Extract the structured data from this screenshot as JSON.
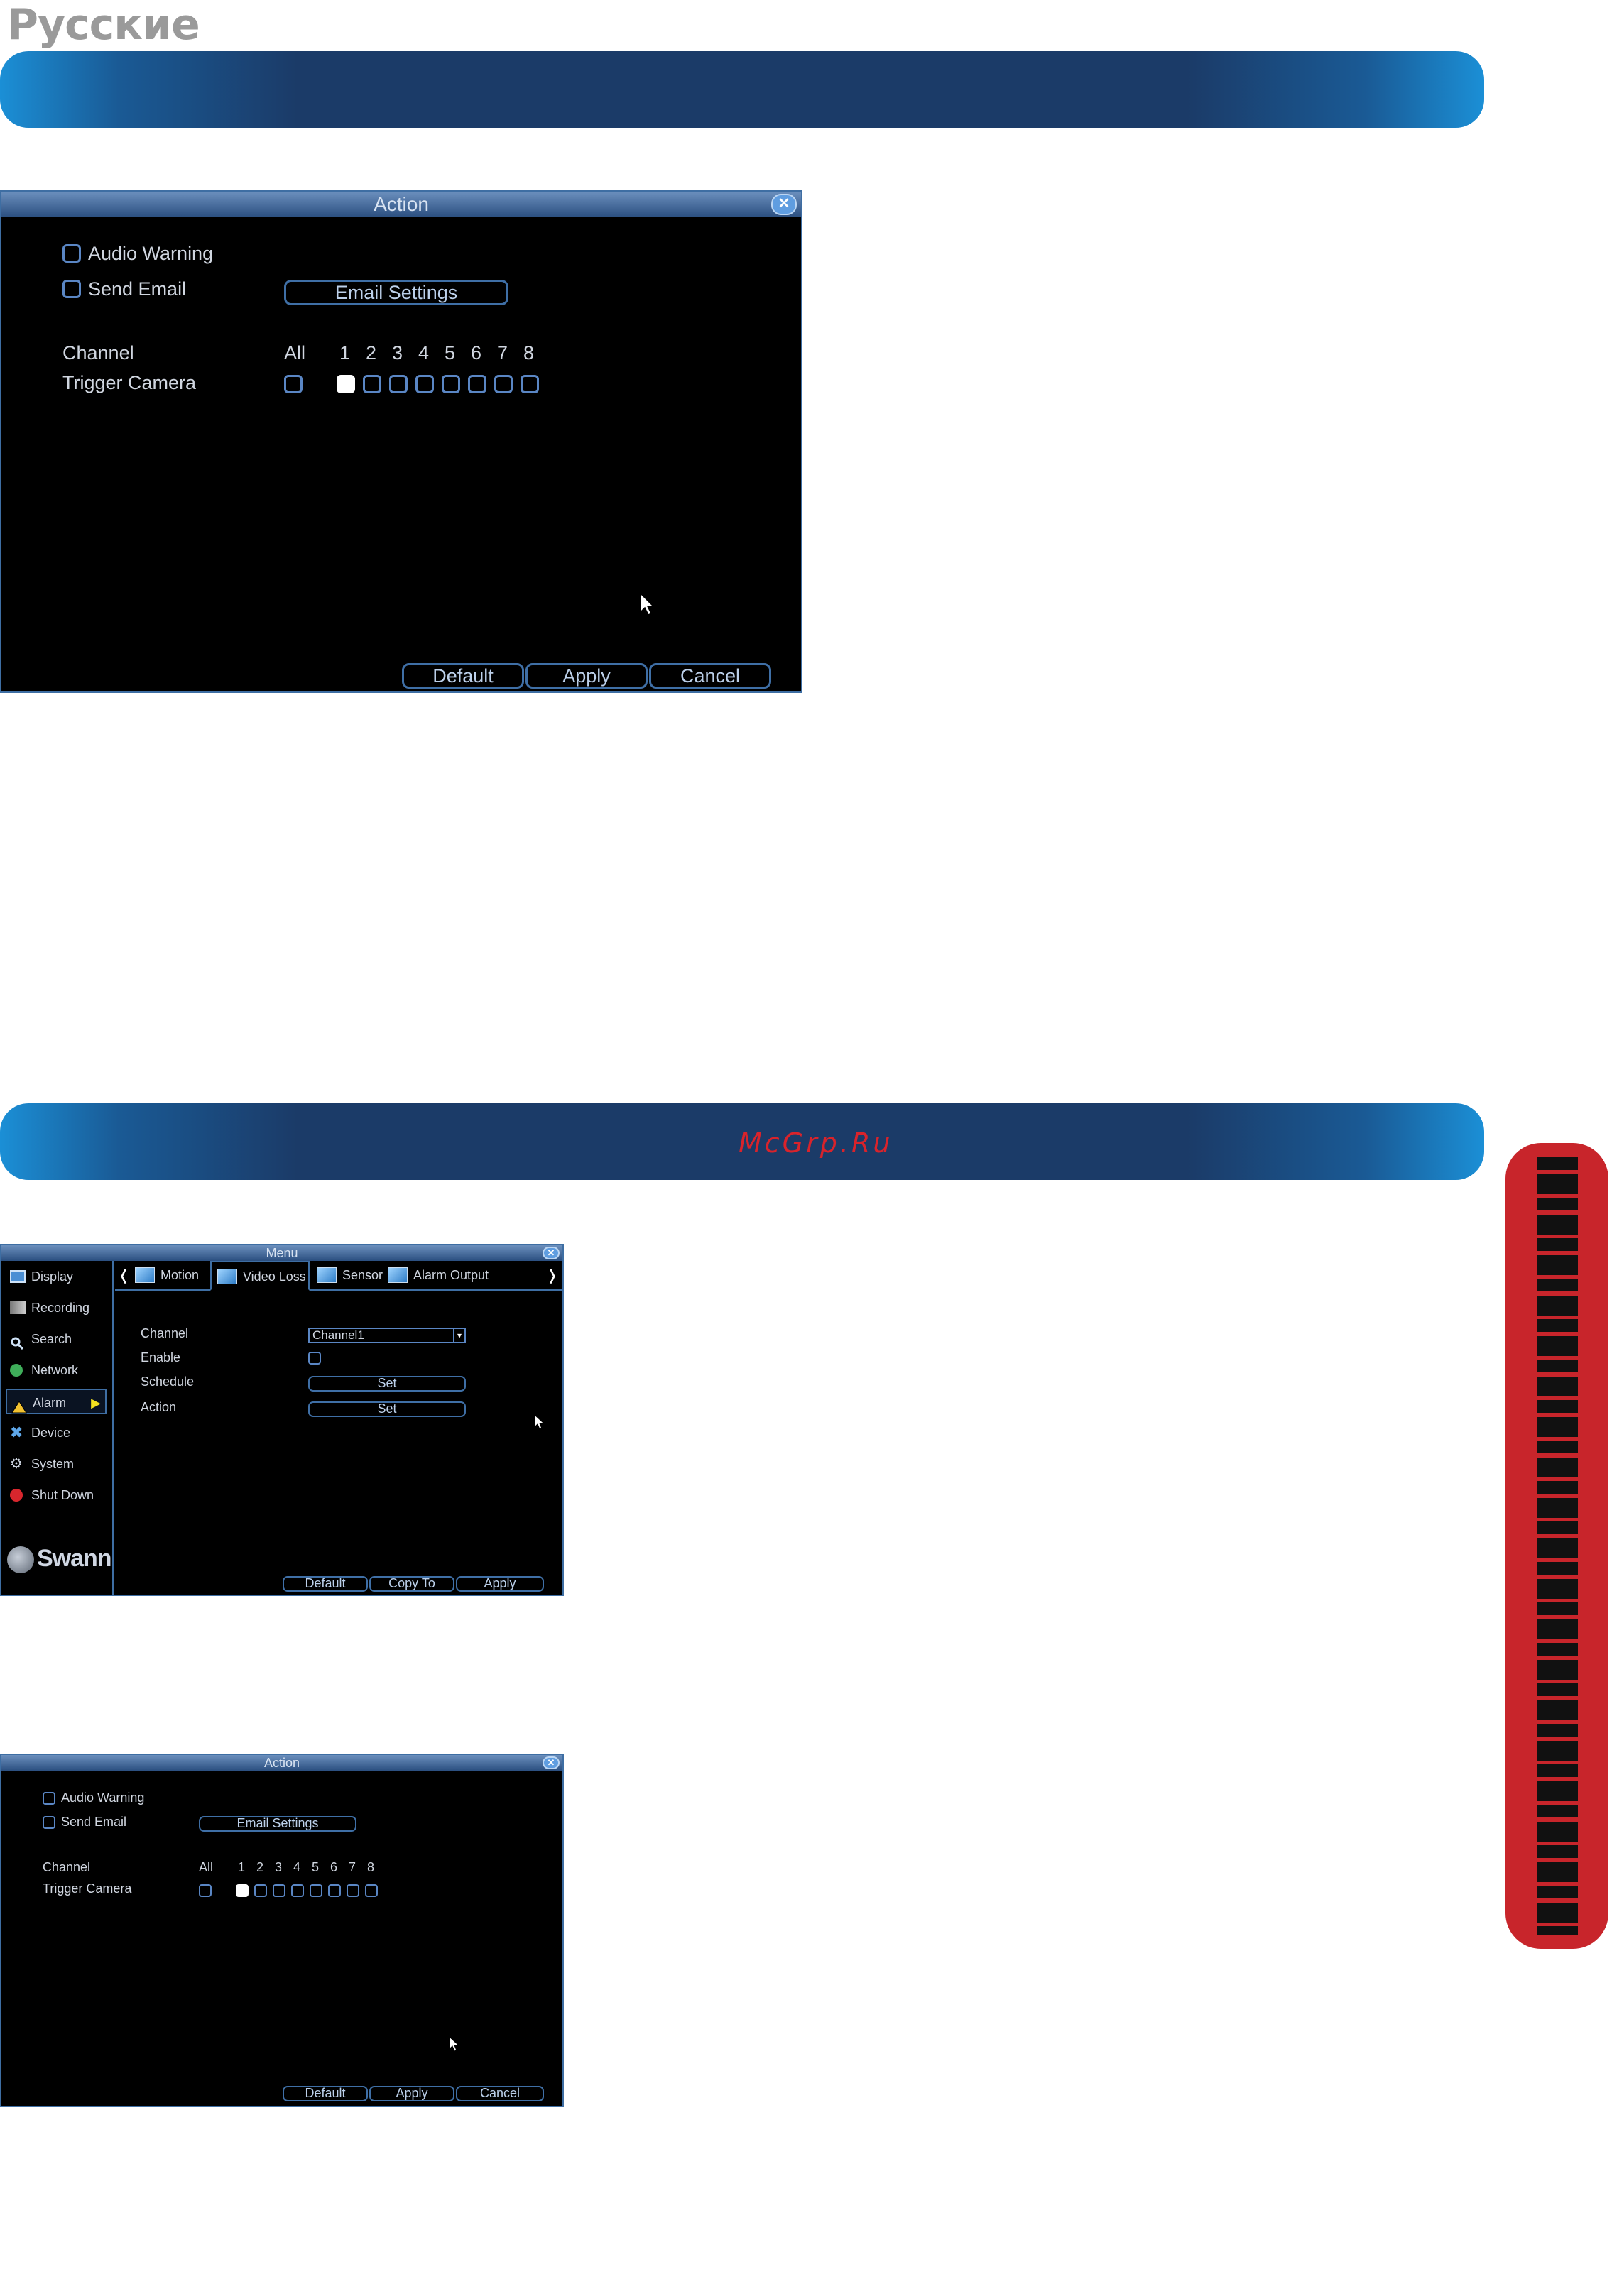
{
  "page": {
    "language_title": "Русские",
    "watermark": "McGrp.Ru"
  },
  "colors": {
    "banner": "#1b3b68",
    "banner_edge": "#1b8fd6",
    "side_tab": "#c8252b",
    "watermark": "#d9232b"
  },
  "action_window": {
    "title": "Action",
    "close_icon": "close-icon",
    "audio_warning": "Audio Warning",
    "send_email": "Send Email",
    "email_settings": "Email Settings",
    "channel_label": "Channel",
    "all_label": "All",
    "channels": [
      "1",
      "2",
      "3",
      "4",
      "5",
      "6",
      "7",
      "8"
    ],
    "trigger_camera": "Trigger Camera",
    "trigger_checked": [
      true,
      false,
      false,
      false,
      false,
      false,
      false,
      false
    ],
    "buttons": {
      "default": "Default",
      "apply": "Apply",
      "cancel": "Cancel"
    }
  },
  "menu_window": {
    "title": "Menu",
    "sidebar": [
      {
        "label": "Display",
        "icon": "display-icon"
      },
      {
        "label": "Recording",
        "icon": "recording-icon"
      },
      {
        "label": "Search",
        "icon": "search-icon"
      },
      {
        "label": "Network",
        "icon": "network-icon"
      },
      {
        "label": "Alarm",
        "icon": "alarm-icon"
      },
      {
        "label": "Device",
        "icon": "device-icon"
      },
      {
        "label": "System",
        "icon": "system-icon"
      },
      {
        "label": "Shut Down",
        "icon": "shutdown-icon"
      }
    ],
    "active_item": "Alarm",
    "logo": "Swann",
    "tabs": [
      "Motion",
      "Video Loss",
      "Sensor",
      "Alarm Output"
    ],
    "active_tab": "Video Loss",
    "fields": {
      "channel_label": "Channel",
      "channel_value": "Channel1",
      "enable_label": "Enable",
      "schedule_label": "Schedule",
      "schedule_button": "Set",
      "action_label": "Action",
      "action_button": "Set"
    },
    "buttons": {
      "default": "Default",
      "copy_to": "Copy To",
      "apply": "Apply"
    }
  }
}
